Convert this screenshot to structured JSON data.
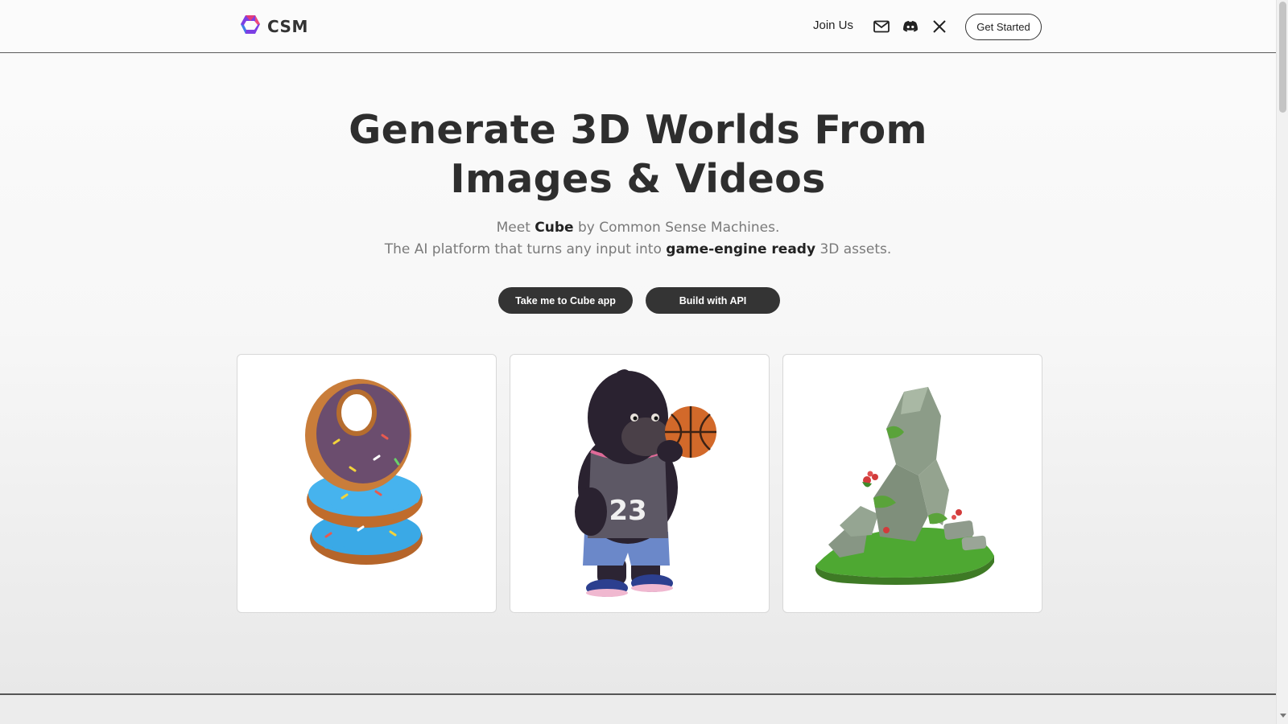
{
  "header": {
    "logo_text": "CSM",
    "join_label": "Join Us",
    "get_started_label": "Get Started",
    "icons": [
      "mail-icon",
      "discord-icon",
      "x-icon"
    ]
  },
  "hero": {
    "title_line1": "Generate 3D Worlds From",
    "title_line2": "Images & Videos",
    "sub1_pre": "Meet ",
    "sub1_bold": "Cube",
    "sub1_post": " by Common Sense Machines.",
    "sub2_pre": "The AI platform that turns any input into ",
    "sub2_bold": "game-engine ready",
    "sub2_post": " 3D assets."
  },
  "cta": {
    "app_label": "Take me to Cube app",
    "api_label": "Build with API"
  },
  "showcase": [
    {
      "subject": "stacked donuts"
    },
    {
      "subject": "gorilla basketball player"
    },
    {
      "subject": "mossy rock formation"
    }
  ],
  "colors": {
    "accent_dark": "#343434",
    "logo_purple": "#7b3fe4",
    "logo_pink": "#e23b7a",
    "logo_blue": "#3f7fe8"
  }
}
